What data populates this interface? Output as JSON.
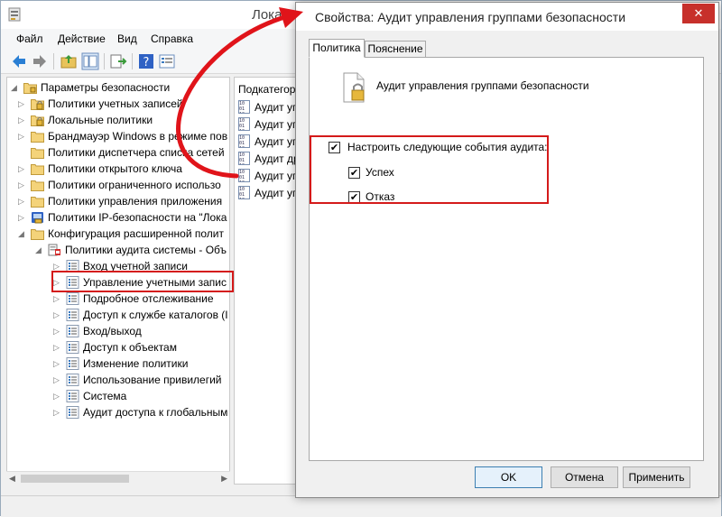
{
  "background_window": {
    "title": "Лока",
    "menu": [
      "Файл",
      "Действие",
      "Вид",
      "Справка"
    ],
    "tree": [
      {
        "label": "Параметры безопасности",
        "indent": 0,
        "twisty": "open",
        "icon": "security-settings-icon"
      },
      {
        "label": "Политики учетных записей",
        "indent": 1,
        "twisty": "closed",
        "icon": "lock-folder-icon"
      },
      {
        "label": "Локальные политики",
        "indent": 1,
        "twisty": "closed",
        "icon": "lock-folder-icon"
      },
      {
        "label": "Брандмауэр Windows в режиме пов",
        "indent": 1,
        "twisty": "closed",
        "icon": "folder-icon"
      },
      {
        "label": "Политики диспетчера списка сетей",
        "indent": 1,
        "twisty": "none",
        "icon": "folder-icon"
      },
      {
        "label": "Политики открытого ключа",
        "indent": 1,
        "twisty": "closed",
        "icon": "folder-icon"
      },
      {
        "label": "Политики ограниченного использо",
        "indent": 1,
        "twisty": "closed",
        "icon": "folder-icon"
      },
      {
        "label": "Политики управления приложения",
        "indent": 1,
        "twisty": "closed",
        "icon": "folder-icon"
      },
      {
        "label": "Политики IP-безопасности на \"Лока",
        "indent": 1,
        "twisty": "closed",
        "icon": "ipsec-icon"
      },
      {
        "label": "Конфигурация расширенной полит",
        "indent": 1,
        "twisty": "open",
        "icon": "folder-icon"
      },
      {
        "label": "Политики аудита системы - Объ",
        "indent": 2,
        "twisty": "open",
        "icon": "audit-policy-icon"
      },
      {
        "label": "Вход учетной записи",
        "indent": 3,
        "twisty": "closed",
        "icon": "audit-category-icon"
      },
      {
        "label": "Управление учетными запис",
        "indent": 3,
        "twisty": "closed",
        "icon": "audit-category-icon"
      },
      {
        "label": "Подробное отслеживание",
        "indent": 3,
        "twisty": "closed",
        "icon": "audit-category-icon"
      },
      {
        "label": "Доступ к службе каталогов (I",
        "indent": 3,
        "twisty": "closed",
        "icon": "audit-category-icon"
      },
      {
        "label": "Вход/выход",
        "indent": 3,
        "twisty": "closed",
        "icon": "audit-category-icon"
      },
      {
        "label": "Доступ к объектам",
        "indent": 3,
        "twisty": "closed",
        "icon": "audit-category-icon"
      },
      {
        "label": "Изменение политики",
        "indent": 3,
        "twisty": "closed",
        "icon": "audit-category-icon"
      },
      {
        "label": "Использование привилегий",
        "indent": 3,
        "twisty": "closed",
        "icon": "audit-category-icon"
      },
      {
        "label": "Система",
        "indent": 3,
        "twisty": "closed",
        "icon": "audit-category-icon"
      },
      {
        "label": "Аудит доступа к глобальным",
        "indent": 3,
        "twisty": "closed",
        "icon": "audit-category-icon"
      }
    ],
    "right_pane": {
      "header": "Подкатегор",
      "items": [
        "Аудит уп",
        "Аудит уп",
        "Аудит уп",
        "Аудит др",
        "Аудит уп",
        "Аудит уп"
      ]
    }
  },
  "dialog": {
    "title": "Свойства: Аудит управления группами безопасности",
    "close_label": "✕",
    "tabs": [
      "Политика",
      "Пояснение"
    ],
    "policy_name": "Аудит управления группами безопасности",
    "configure_label": "Настроить следующие события аудита:",
    "configure_checked": true,
    "success_label": "Успех",
    "success_checked": true,
    "failure_label": "Отказ",
    "failure_checked": true,
    "buttons": {
      "ok": "OK",
      "cancel": "Отмена",
      "apply": "Применить"
    }
  },
  "colors": {
    "highlight": "#d41a1a",
    "arrow": "#e0141a",
    "close_button": "#c7302b"
  }
}
